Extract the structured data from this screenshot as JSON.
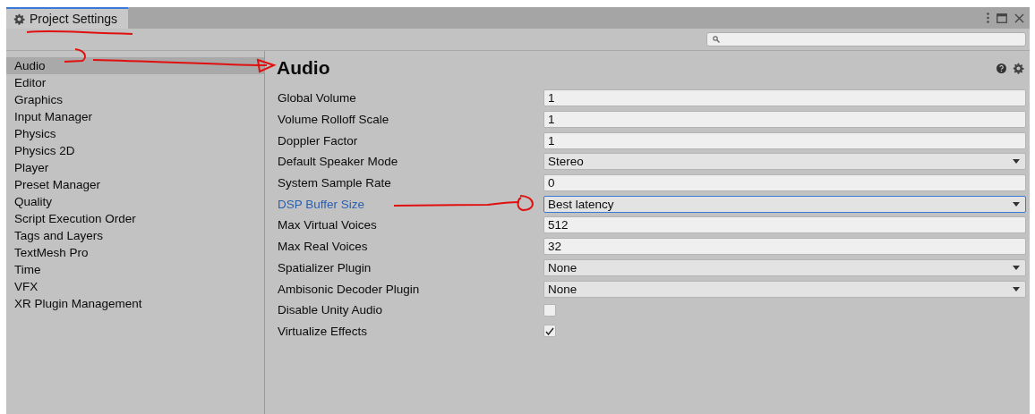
{
  "window": {
    "tab_title": "Project Settings"
  },
  "sidebar": {
    "items": [
      {
        "label": "Audio",
        "selected": true
      },
      {
        "label": "Editor",
        "selected": false
      },
      {
        "label": "Graphics",
        "selected": false
      },
      {
        "label": "Input Manager",
        "selected": false
      },
      {
        "label": "Physics",
        "selected": false
      },
      {
        "label": "Physics 2D",
        "selected": false
      },
      {
        "label": "Player",
        "selected": false
      },
      {
        "label": "Preset Manager",
        "selected": false
      },
      {
        "label": "Quality",
        "selected": false
      },
      {
        "label": "Script Execution Order",
        "selected": false
      },
      {
        "label": "Tags and Layers",
        "selected": false
      },
      {
        "label": "TextMesh Pro",
        "selected": false
      },
      {
        "label": "Time",
        "selected": false
      },
      {
        "label": "VFX",
        "selected": false
      },
      {
        "label": "XR Plugin Management",
        "selected": false
      }
    ]
  },
  "inspector": {
    "title": "Audio",
    "fields": [
      {
        "label": "Global Volume",
        "kind": "text",
        "value": "1",
        "focused": false
      },
      {
        "label": "Volume Rolloff Scale",
        "kind": "text",
        "value": "1",
        "focused": false
      },
      {
        "label": "Doppler Factor",
        "kind": "text",
        "value": "1",
        "focused": false
      },
      {
        "label": "Default Speaker Mode",
        "kind": "dropdown",
        "value": "Stereo",
        "focused": false
      },
      {
        "label": "System Sample Rate",
        "kind": "text",
        "value": "0",
        "focused": false
      },
      {
        "label": "DSP Buffer Size",
        "kind": "dropdown",
        "value": "Best latency",
        "focused": true
      },
      {
        "label": "Max Virtual Voices",
        "kind": "text",
        "value": "512",
        "focused": false
      },
      {
        "label": "Max Real Voices",
        "kind": "text",
        "value": "32",
        "focused": false
      },
      {
        "label": "Spatializer Plugin",
        "kind": "dropdown",
        "value": "None",
        "focused": false
      },
      {
        "label": "Ambisonic Decoder Plugin",
        "kind": "dropdown",
        "value": "None",
        "focused": false
      },
      {
        "label": "Disable Unity Audio",
        "kind": "checkbox",
        "checked": false,
        "focused": false
      },
      {
        "label": "Virtualize Effects",
        "kind": "checkbox",
        "checked": true,
        "focused": false
      }
    ]
  }
}
